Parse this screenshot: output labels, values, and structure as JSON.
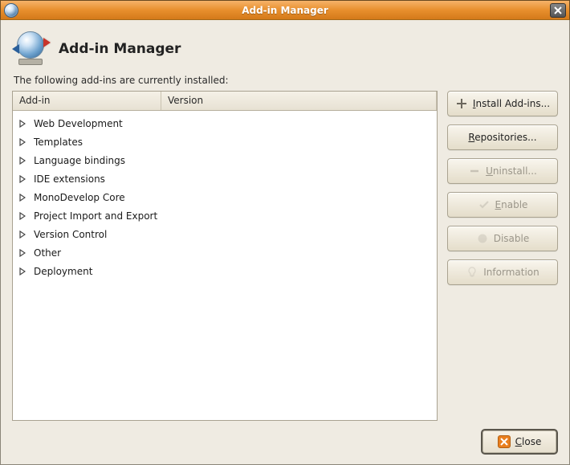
{
  "window": {
    "title": "Add-in Manager"
  },
  "header": {
    "title": "Add-in Manager"
  },
  "intro": "The following add-ins are currently installed:",
  "columns": {
    "addin": "Add-in",
    "version": "Version"
  },
  "tree": {
    "items": [
      {
        "label": "Web Development"
      },
      {
        "label": "Templates"
      },
      {
        "label": "Language bindings"
      },
      {
        "label": "IDE extensions"
      },
      {
        "label": "MonoDevelop Core"
      },
      {
        "label": "Project Import and Export"
      },
      {
        "label": "Version Control"
      },
      {
        "label": "Other"
      },
      {
        "label": "Deployment"
      }
    ]
  },
  "buttons": {
    "install_pre": "I",
    "install_post": "nstall Add-ins...",
    "repos_pre": "R",
    "repos_post": "epositories...",
    "uninstall_pre": "U",
    "uninstall_post": "ninstall...",
    "enable_pre": "E",
    "enable_post": "nable",
    "disable": "Disable",
    "information": "Information",
    "close_pre": "C",
    "close_post": "lose"
  }
}
